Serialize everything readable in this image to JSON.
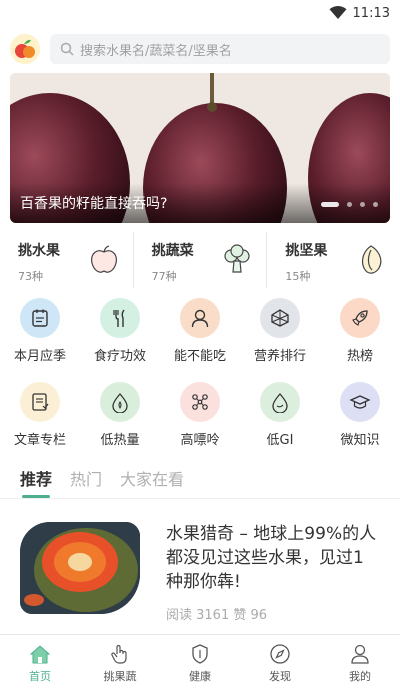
{
  "status": {
    "time": "11:13"
  },
  "search": {
    "placeholder": "搜索水果名/蔬菜名/坚果名"
  },
  "banner": {
    "caption": "百香果的籽能直接吞吗?"
  },
  "picks": [
    {
      "title": "挑水果",
      "count": "73种"
    },
    {
      "title": "挑蔬菜",
      "count": "77种"
    },
    {
      "title": "挑坚果",
      "count": "15种"
    }
  ],
  "grid": [
    {
      "label": "本月应季",
      "color": "#cfe6f7"
    },
    {
      "label": "食疗功效",
      "color": "#d3f0e3"
    },
    {
      "label": "能不能吃",
      "color": "#f9ddc8"
    },
    {
      "label": "营养排行",
      "color": "#e1e4e9"
    },
    {
      "label": "热榜",
      "color": "#fbd9c6"
    },
    {
      "label": "文章专栏",
      "color": "#fbf0d6"
    },
    {
      "label": "低热量",
      "color": "#d9efdc"
    },
    {
      "label": "高嘌呤",
      "color": "#fbe1dd"
    },
    {
      "label": "低GI",
      "color": "#dcefdf"
    },
    {
      "label": "微知识",
      "color": "#dde0f5"
    }
  ],
  "tabs": [
    "推荐",
    "热门",
    "大家在看"
  ],
  "article": {
    "title": "水果猎奇 – 地球上99%的人都没见过这些水果，见过1种那你犇!",
    "meta": "阅读 3161  赞 96"
  },
  "nav": [
    {
      "label": "首页"
    },
    {
      "label": "挑果蔬"
    },
    {
      "label": "健康"
    },
    {
      "label": "发现"
    },
    {
      "label": "我的"
    }
  ],
  "colors": {
    "accent": "#4cb08c"
  }
}
